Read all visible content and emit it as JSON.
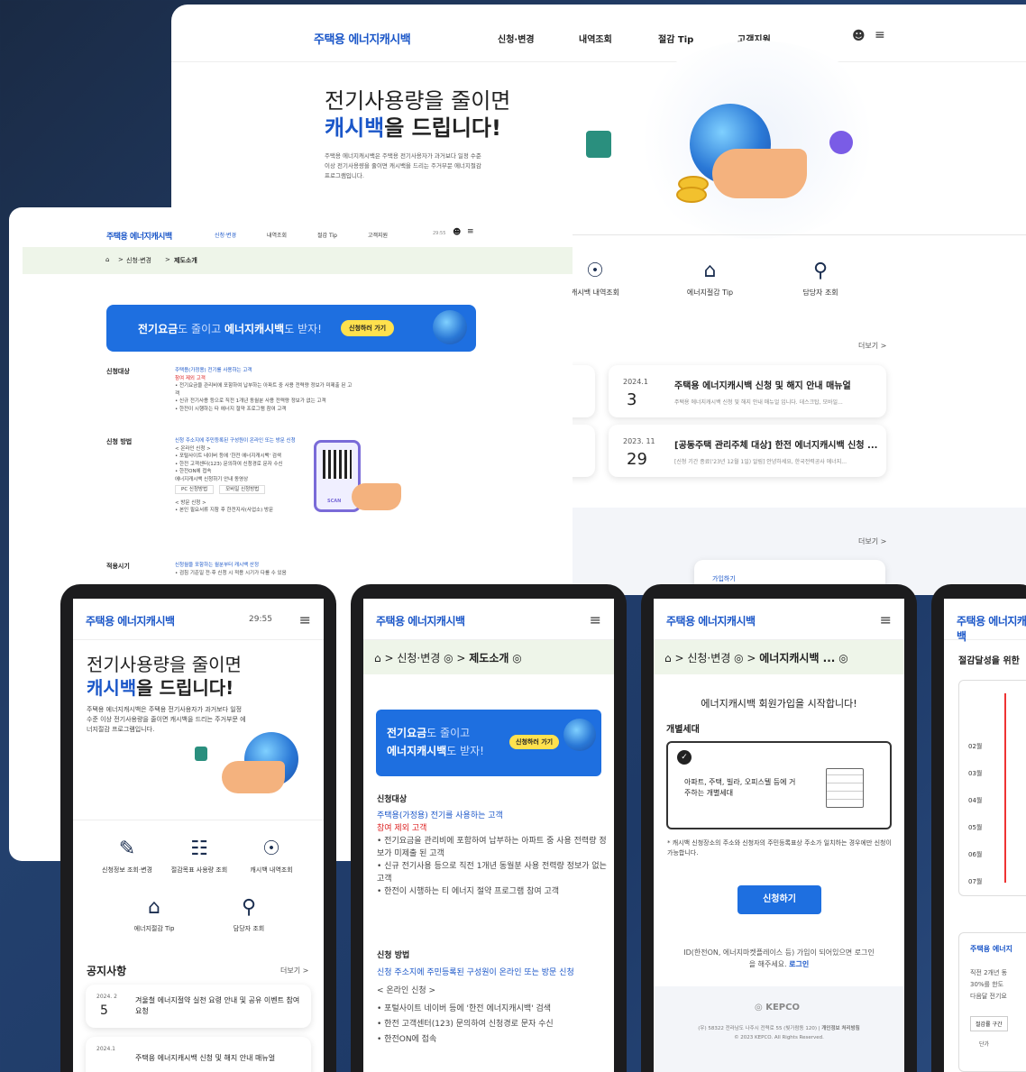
{
  "brand": "주택용 에너지캐시백",
  "desktop": {
    "nav": [
      "신청·변경",
      "내역조회",
      "절감 Tip",
      "고객지원"
    ],
    "hero_title_line1": "전기사용량을 줄이면",
    "hero_title_hl": "캐시백",
    "hero_title_rest": "을 드립니다!",
    "hero_desc": "주택용 에너지캐시백은 주택용 전기사용자가 과거보다 일정 수준 이상 전기사용량을 줄이면 캐시백을 드리는 주거부문 에너지절감 프로그램입니다.",
    "quick": [
      "캐시백 내역조회",
      "에너지절감 Tip",
      "담당자 조회"
    ],
    "more": "더보기 >",
    "notices": [
      {
        "ym": "2024.1",
        "day": "3",
        "title": "주택용 에너지캐시백 신청 및 해지 안내 매뉴얼",
        "desc": "주택용 에너지캐시백 신청 및 해지 안내 매뉴얼 입니다. 데스크탑, 모바일..."
      },
      {
        "ym": "2023. 11",
        "day": "29",
        "title": "[공동주택 관리주체 대상] 한전 에너지캐시백 신청 ...",
        "desc": "[신청 기간 종료('23년 12월 1일) 알림] 안녕하세요, 한국전력공사 에너지..."
      }
    ],
    "join": "가입하기"
  },
  "desktop2": {
    "nav": [
      "신청·변경",
      "내역조회",
      "절감 Tip",
      "고객지원"
    ],
    "timer": "29:55",
    "crumb": [
      "신청·변경",
      "제도소개"
    ],
    "banner_a": "전기요금",
    "banner_b": "도 줄이고 ",
    "banner_c": "에너지캐시백",
    "banner_d": "도 받자!",
    "banner_btn": "신청하러 가기",
    "s1": "신청대상",
    "s1_lines": [
      "주택용(가정용) 전기를 사용하는 고객",
      "참여 제외 고객",
      "• 전기요금을 관리비에 포함하여 납부하는 아파트 중 사용 전력량 정보가 미제출 된 고객",
      "• 신규 전기사용 등으로 직전 1개년 동월분 사용 전력량 정보가 없는 고객",
      "• 한전이 시행하는 타 에너지 절약 프로그램 참여 고객"
    ],
    "s2": "신청 방법",
    "s2_lines": [
      "신청 주소지에 주민등록된 구성원이 온라인 또는 방문 신청",
      "< 온라인 신청 >",
      "• 포털사이트 네이버 등에 '한전 에너지캐시백' 검색",
      "• 한전 고객센터(123) 문의하여 신청경로 문자 수신",
      "• 한전ON에 접속",
      "에너지캐시백 신청하기 안내 동영상",
      "PC 신청방법",
      "모바일 신청방법",
      "< 방문 신청 >",
      "• 본인 필요서류 지참 후 한전지사(사업소) 방문"
    ],
    "s3": "적용시기",
    "s3_lines": [
      "신청월을 포함하는 월분부터 캐시백 산정",
      "• 검침 기준일 전·후 신청 시 적용 시기가 다를 수 있음"
    ],
    "scan": "SCAN"
  },
  "phones": {
    "p1": {
      "timer": "29:55",
      "title1": "전기사용량을 줄이면",
      "hl": "캐시백",
      "rest": "을 드립니다!",
      "desc": "주택용 에너지캐시백은 주택용 전기사용자가 과거보다 일정 수준 이상 전기사용량을 줄이면 캐시백을 드리는 주거부문 에너지절감 프로그램입니다.",
      "quick": [
        "신청정보 조회·변경",
        "절감목표 사용량 조회",
        "캐시백 내역조회",
        "에너지절감 Tip",
        "담당자 조회"
      ],
      "notice": "공지사항",
      "more": "더보기 >",
      "n1_ym": "2024. 2",
      "n1_day": "5",
      "n1_title": "겨울철 에너지절약 실천 요령 안내 및 공유 이벤트 참여 요청",
      "n2_ym": "2024.1",
      "n2_title": "주택용 에너지캐시백 신청 및 해지 안내 매뉴얼"
    },
    "p2": {
      "crumb1": "신청·변경",
      "crumb2": "제도소개",
      "b1": "전기요금",
      "b2": "도 줄이고",
      "b3": "에너지캐시백",
      "b4": "도 받자!",
      "btn": "신청하러 가기",
      "s1": "신청대상",
      "s1a": "주택용(가정용) 전기를 사용하는 고객",
      "s1b": "참여 제외 고객",
      "s1c": "• 전기요금을 관리비에 포함하여 납부하는 아파트 중 사용 전력량 정보가 미제출 된 고객",
      "s1d": "• 신규 전기사용 등으로 직전 1개년 동월분 사용 전력량 정보가 없는 고객",
      "s1e": "• 한전이 시행하는 티 에너지 절약 프로그램 참여 고객",
      "s2": "신청 방법",
      "s2a": "신청 주소지에 주민등록된 구성원이 온라인 또는 방문 신청",
      "s2b": "< 온라인 신청 >",
      "s2c": "• 포털사이트 네이버 등에 '한전 에너지캐시백' 검색",
      "s2d": "• 한전 고객센터(123) 문의하여 신청경로 문자 수신",
      "s2e": "• 한전ON에 접속"
    },
    "p3": {
      "crumb1": "신청·변경",
      "crumb2": "에너지캐시백 ...",
      "headline": "에너지캐시백 회원가입을 시작합니다!",
      "type": "개별세대",
      "opt": "아파트, 주택, 빌라, 오피스텔 등에 거주하는 개별세대",
      "note": "* 캐시백 신청장소의 주소와 신청자의 주민등록표상 주소가 일치하는 경우에만 신청이 가능합니다.",
      "btn": "신청하기",
      "login_note": "ID(한전ON, 에너지마켓플레이스 등) 가입이 되어있으면 로그인을 해주세요.",
      "login": "로그인",
      "footer1": "(우) 58322 전라남도 나주시 전력로 55 (빛가람동 120)",
      "footer2": "개인정보 처리방침",
      "footer3": "© 2023 KEPCO. All Rights Reserved."
    },
    "p4": {
      "title": "절감달성을 위한",
      "months": [
        "02월",
        "03월",
        "04월",
        "05월",
        "06월",
        "07월"
      ],
      "sub": "주택용 에너지",
      "a": "직전 2개년 동",
      "b": "30%를 한도",
      "c": "다음달 전기요",
      "tab1": "절감률 구간",
      "tab2": "단가"
    }
  }
}
